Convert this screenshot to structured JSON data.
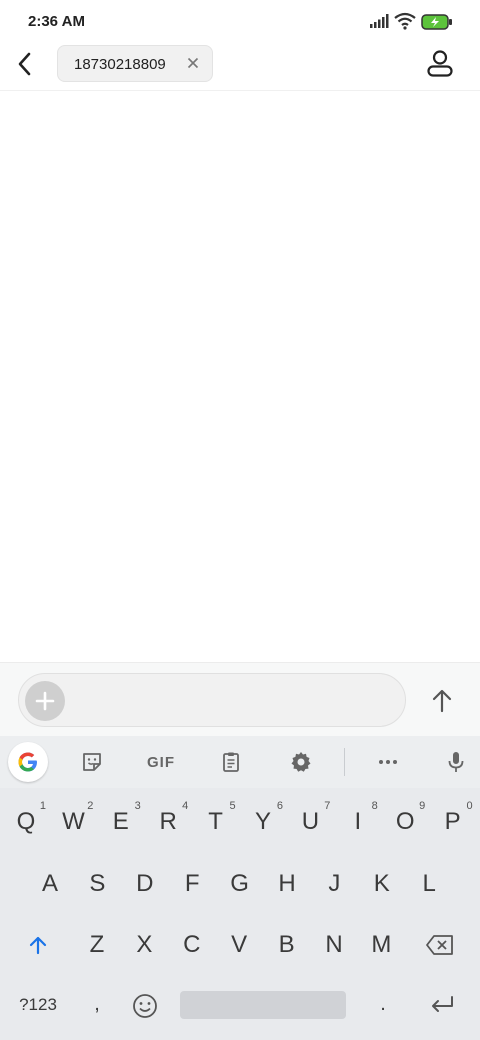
{
  "status_bar": {
    "time": "2:36 AM",
    "icons": [
      "signal-icon",
      "wifi-icon",
      "battery-charging-icon"
    ]
  },
  "header": {
    "recipient": "18730218809",
    "icons": [
      "back-arrow-icon",
      "clear-recipient-icon",
      "contact-icon"
    ]
  },
  "compose": {
    "placeholder": "",
    "icons": [
      "attach-plus-icon",
      "send-arrow-icon"
    ]
  },
  "keyboard": {
    "toolbar": [
      "google-icon",
      "sticker-icon",
      "gif-icon",
      "clipboard-icon",
      "settings-gear-icon",
      "more-icon",
      "mic-icon"
    ],
    "gif_label": "GIF",
    "row1": [
      {
        "k": "Q",
        "n": "1"
      },
      {
        "k": "W",
        "n": "2"
      },
      {
        "k": "E",
        "n": "3"
      },
      {
        "k": "R",
        "n": "4"
      },
      {
        "k": "T",
        "n": "5"
      },
      {
        "k": "Y",
        "n": "6"
      },
      {
        "k": "U",
        "n": "7"
      },
      {
        "k": "I",
        "n": "8"
      },
      {
        "k": "O",
        "n": "9"
      },
      {
        "k": "P",
        "n": "0"
      }
    ],
    "row2": [
      "A",
      "S",
      "D",
      "F",
      "G",
      "H",
      "J",
      "K",
      "L"
    ],
    "row3": [
      "Z",
      "X",
      "C",
      "V",
      "B",
      "N",
      "M"
    ],
    "symbols_label": "?123",
    "comma": ",",
    "period": ".",
    "accent_color": "#1a73e8"
  }
}
